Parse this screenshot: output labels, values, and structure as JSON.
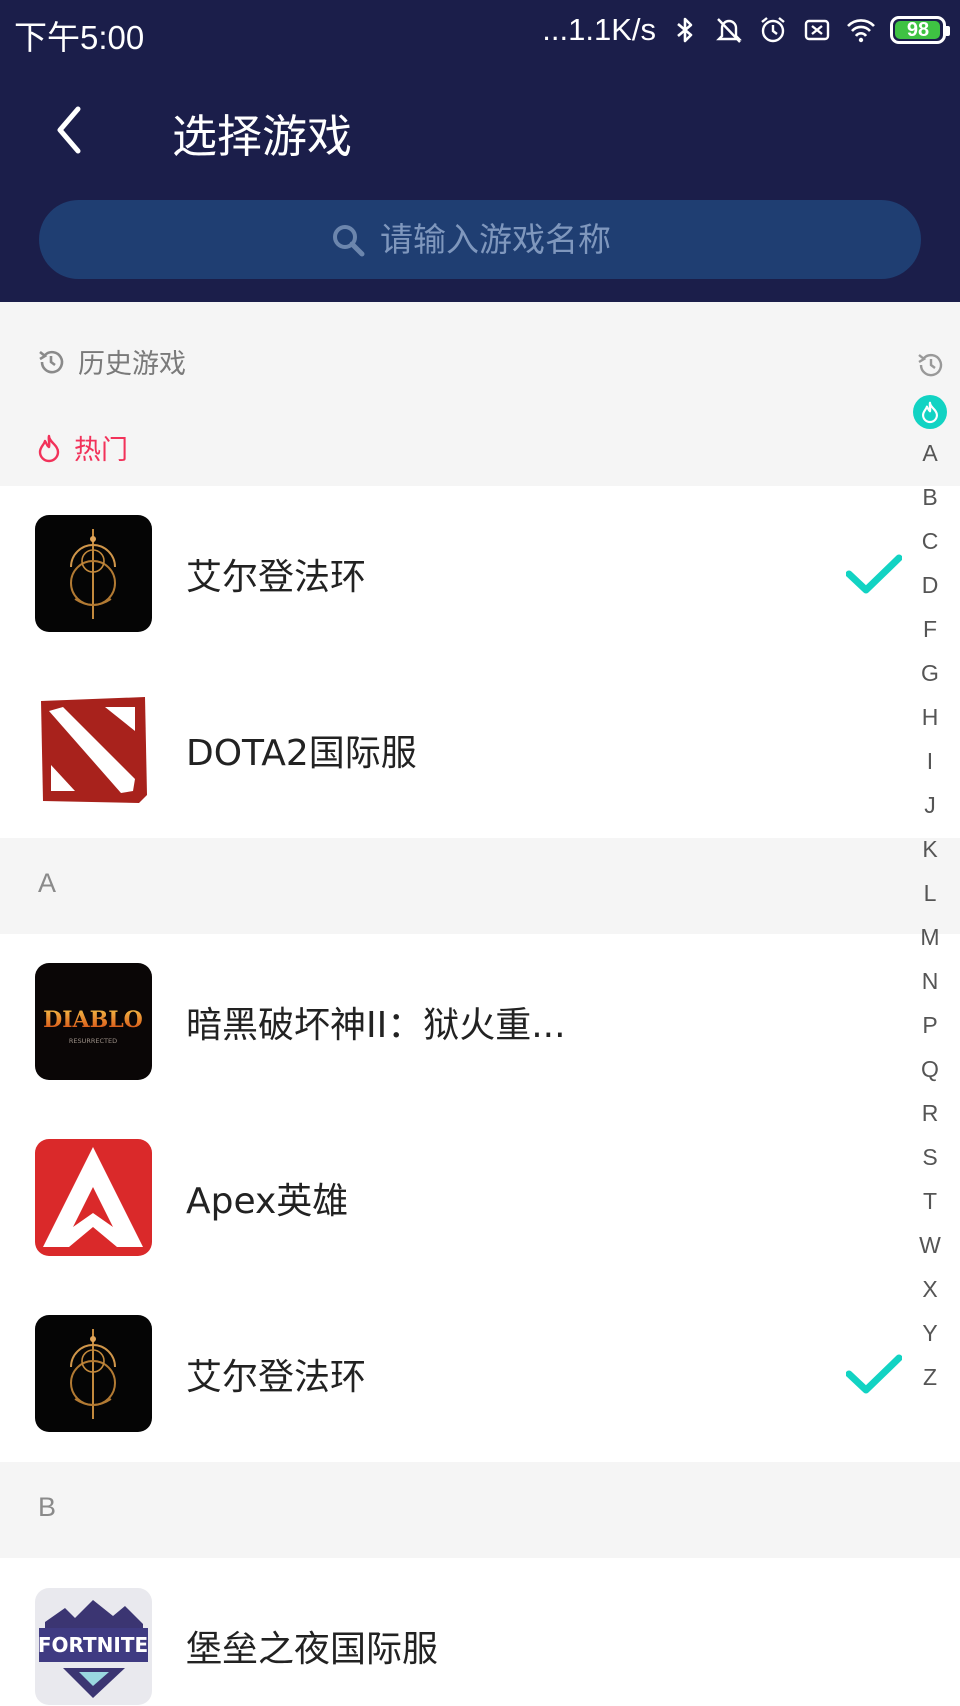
{
  "status_bar": {
    "time": "下午5:00",
    "network_speed": "...1.1K/s",
    "battery_level": "98",
    "battery_color": "#3fc243",
    "icons": [
      "bluetooth-icon",
      "mute-icon",
      "alarm-icon",
      "sim-off-icon",
      "wifi-icon",
      "battery-icon"
    ]
  },
  "header": {
    "title": "选择游戏",
    "background": "#1b1e4a",
    "back_icon": "chevron-left-icon"
  },
  "search": {
    "placeholder": "请输入游戏名称",
    "icon": "search-icon"
  },
  "sections": {
    "history_label": "历史游戏",
    "hot_label": "热门",
    "hot_color": "#f2325a"
  },
  "hot_games": [
    {
      "name": "艾尔登法环",
      "icon": "elden-ring-icon",
      "selected": true
    },
    {
      "name": "DOTA2国际服",
      "icon": "dota2-icon",
      "selected": false
    }
  ],
  "groups": [
    {
      "letter": "A",
      "games": [
        {
          "name": "暗黑破坏神II：狱火重...",
          "icon": "diablo-icon",
          "selected": false
        },
        {
          "name": "Apex英雄",
          "icon": "apex-icon",
          "selected": false
        },
        {
          "name": "艾尔登法环",
          "icon": "elden-ring-icon",
          "selected": true
        }
      ]
    },
    {
      "letter": "B",
      "games": [
        {
          "name": "堡垒之夜国际服",
          "icon": "fortnite-icon",
          "selected": false
        }
      ]
    }
  ],
  "logo_texts": {
    "diablo": "DIABLO",
    "diablo_sub": "RESURRECTED",
    "fortnite": "FORTNITE"
  },
  "check_color": "#12d3c3",
  "index_letters": [
    "A",
    "B",
    "C",
    "D",
    "F",
    "G",
    "H",
    "I",
    "J",
    "K",
    "L",
    "M",
    "N",
    "P",
    "Q",
    "R",
    "S",
    "T",
    "W",
    "X",
    "Y",
    "Z"
  ]
}
